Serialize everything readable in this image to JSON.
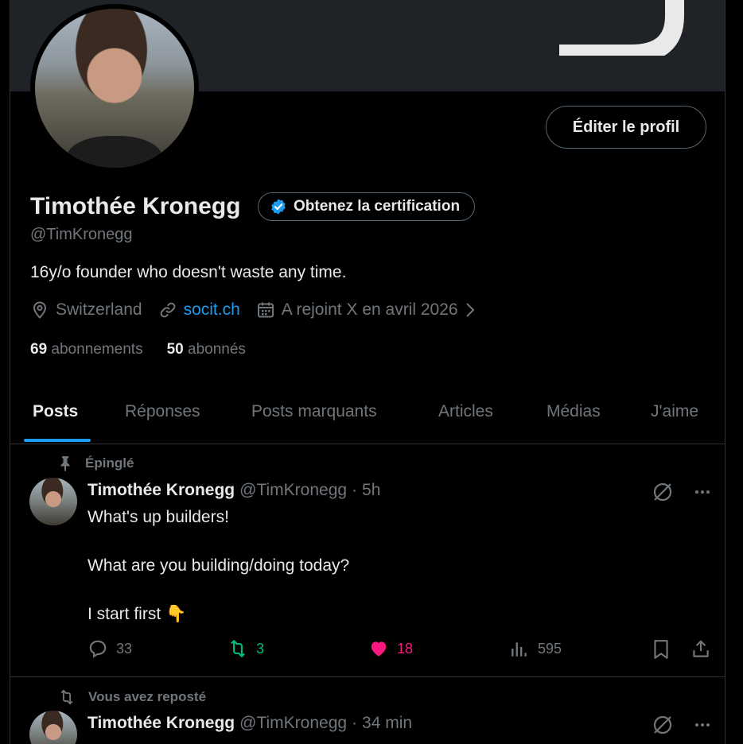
{
  "profile": {
    "name": "Timothée Kronegg",
    "handle": "@TimKronegg",
    "edit_label": "Éditer le profil",
    "cert_label": "Obtenez la certification",
    "bio": "16y/o founder who doesn't waste any time.",
    "location": "Switzerland",
    "website": "socit.ch",
    "joined": "A rejoint X en avril 2026",
    "following_count": "69",
    "following_label": "abonnements",
    "followers_count": "50",
    "followers_label": "abonnés"
  },
  "tabs": [
    {
      "label": "Posts"
    },
    {
      "label": "Réponses"
    },
    {
      "label": "Posts marquants"
    },
    {
      "label": "Articles"
    },
    {
      "label": "Médias"
    },
    {
      "label": "J'aime"
    }
  ],
  "posts": [
    {
      "context": "Épinglé",
      "name": "Timothée Kronegg",
      "handle": "@TimKronegg",
      "sep": "·",
      "time": "5h",
      "lines": [
        "What's up builders!",
        "What are you building/doing today?",
        "I start first 👇"
      ],
      "replies": "33",
      "reposts": "3",
      "likes": "18",
      "views": "595"
    },
    {
      "context": "Vous avez reposté",
      "name": "Timothée Kronegg",
      "handle": "@TimKronegg",
      "sep": "·",
      "time": "34 min"
    }
  ],
  "colors": {
    "accent": "#1d9bf0",
    "like": "#f91880",
    "repost": "#00ba7c",
    "muted": "#71767b",
    "text": "#e7e9ea"
  }
}
